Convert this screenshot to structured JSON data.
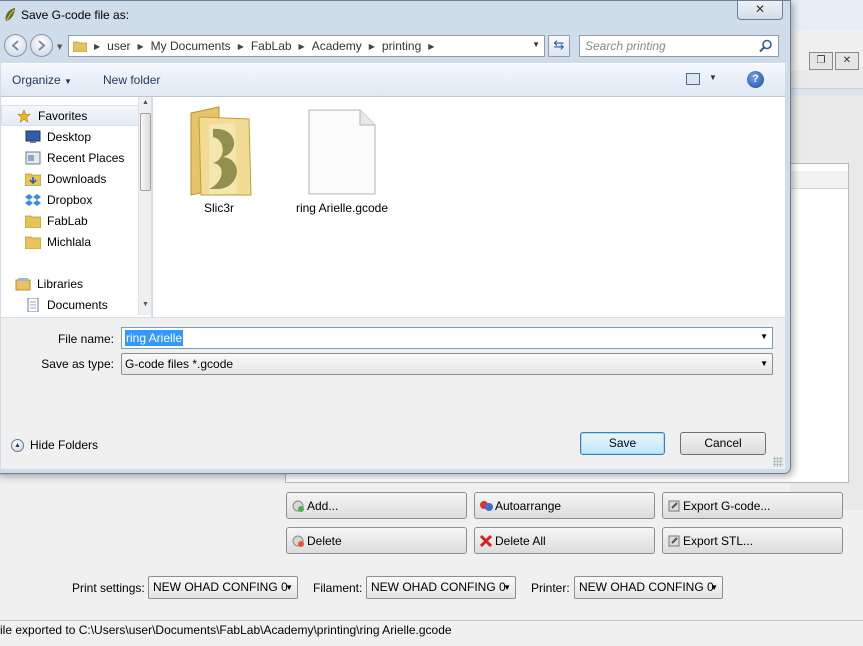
{
  "dialog": {
    "title": "Save G-code file as:",
    "close_glyph": "✕",
    "breadcrumbs": [
      "user",
      "My Documents",
      "FabLab",
      "Academy",
      "printing"
    ],
    "search_placeholder": "Search printing",
    "organize_label": "Organize",
    "new_folder_label": "New folder",
    "help_glyph": "?",
    "nav": {
      "favorites_label": "Favorites",
      "items": [
        "Desktop",
        "Recent Places",
        "Downloads",
        "Dropbox",
        "FabLab",
        "Michlala"
      ],
      "libraries_label": "Libraries",
      "library_items": [
        "Documents"
      ]
    },
    "files": [
      {
        "name": "Slic3r",
        "type": "folder"
      },
      {
        "name": "ring Arielle.gcode",
        "type": "file"
      }
    ],
    "file_name_label": "File name:",
    "file_name_value": "ring Arielle",
    "save_as_type_label": "Save as type:",
    "save_as_type_value": "G-code files *.gcode",
    "hide_folders_label": "Hide Folders",
    "save_label": "Save",
    "cancel_label": "Cancel"
  },
  "app": {
    "buttons": {
      "add": "Add...",
      "autoarrange": "Autoarrange",
      "export_gcode": "Export G-code...",
      "delete": "Delete",
      "delete_all": "Delete All",
      "export_stl": "Export STL..."
    },
    "settings": {
      "print_label": "Print settings:",
      "print_value": "NEW OHAD CONFING 0",
      "filament_label": "Filament:",
      "filament_value": "NEW OHAD CONFING 0",
      "printer_label": "Printer:",
      "printer_value": "NEW OHAD CONFING 0"
    },
    "status_text": "ile exported to C:\\Users\\user\\Documents\\FabLab\\Academy\\printing\\ring Arielle.gcode",
    "window_close_glyph": "✕",
    "window_restore_glyph": "❐"
  },
  "colors": {
    "dialog_frame": "#cfdcea",
    "save_button": "#bee6fd",
    "selection": "#3399ff",
    "link_text": "#1e395b"
  }
}
